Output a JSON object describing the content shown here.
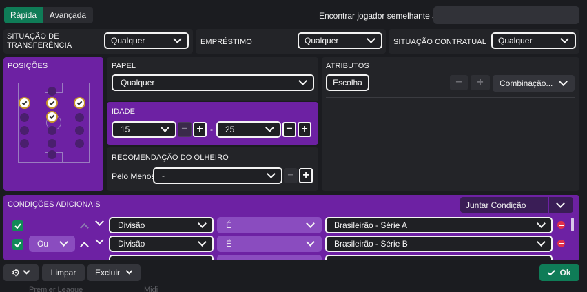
{
  "top_tabs": [
    "Rápida",
    "Avançada"
  ],
  "similar": {
    "label": "Encontrar jogador semelhante a",
    "placeholder": ""
  },
  "row1": {
    "transfer_status": {
      "label": "SITUAÇÃO DE TRANSFERÊNCIA",
      "value": "Qualquer"
    },
    "loan": {
      "label": "EMPRÉSTIMO",
      "value": "Qualquer"
    },
    "contract": {
      "label": "SITUAÇÃO CONTRATUAL",
      "value": "Qualquer"
    }
  },
  "positions": {
    "label": "POSIÇÕES"
  },
  "role": {
    "label": "PAPEL",
    "value": "Qualquer"
  },
  "age": {
    "label": "IDADE",
    "min": "15",
    "max": "25",
    "minus": "−",
    "plus": "+",
    "sep": "-"
  },
  "scout": {
    "label": "RECOMENDAÇÃO DO OLHEIRO",
    "prefix": "Pelo Menos",
    "value": "-"
  },
  "attributes": {
    "label": "ATRIBUTOS",
    "choose": "Escolha",
    "combination": "Combinação..."
  },
  "conditions": {
    "label": "CONDIÇÕES ADICIONAIS",
    "join": "Juntar Condição",
    "rows": [
      {
        "logic": "",
        "field": "Divisão",
        "op": "É",
        "value": "Brasileirão - Série A"
      },
      {
        "logic": "Ou",
        "field": "Divisão",
        "op": "É",
        "value": "Brasileirão - Série B"
      }
    ]
  },
  "bottom": {
    "clear": "Limpar",
    "delete": "Excluir",
    "ok": "Ok"
  },
  "background_text": [
    "Premier League",
    "Midi"
  ],
  "colors": {
    "purple": "#6d21a3",
    "green": "#128a58",
    "red": "#e0304a"
  }
}
